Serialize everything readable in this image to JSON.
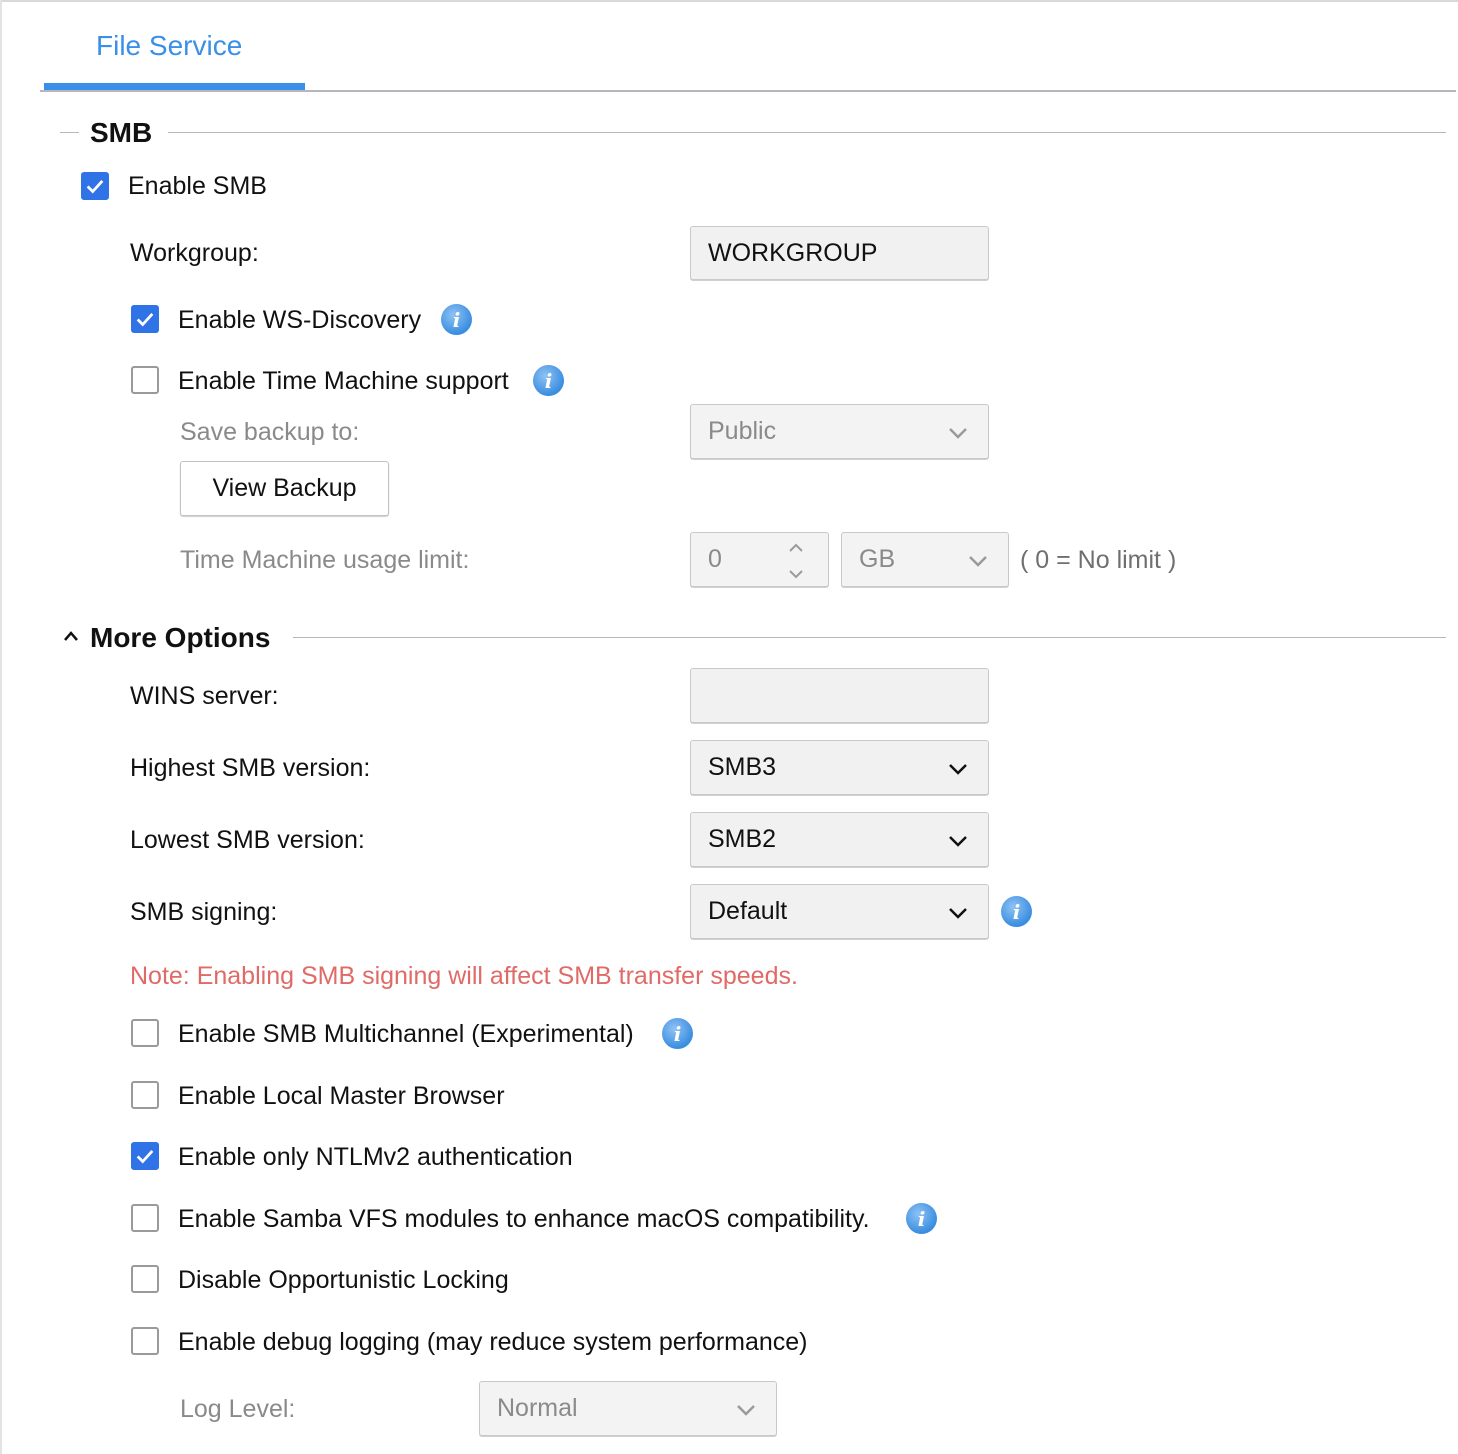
{
  "tab": {
    "label": "File Service"
  },
  "smb_section": {
    "title": "SMB",
    "enable_smb": {
      "label": "Enable SMB",
      "checked": true
    },
    "workgroup": {
      "label": "Workgroup:",
      "value": "WORKGROUP"
    },
    "ws_discovery": {
      "label": "Enable WS-Discovery",
      "checked": true
    },
    "time_machine": {
      "label": "Enable Time Machine support",
      "checked": false
    },
    "save_backup": {
      "label": "Save backup to:",
      "value": "Public"
    },
    "view_backup_button": "View Backup",
    "usage_limit": {
      "label": "Time Machine usage limit:",
      "value": "0",
      "unit": "GB",
      "hint": "( 0 = No limit )"
    }
  },
  "more_options": {
    "title": "More Options",
    "wins_server": {
      "label": "WINS server:",
      "value": ""
    },
    "highest_smb": {
      "label": "Highest SMB version:",
      "value": "SMB3"
    },
    "lowest_smb": {
      "label": "Lowest SMB version:",
      "value": "SMB2"
    },
    "smb_signing": {
      "label": "SMB signing:",
      "value": "Default"
    },
    "note": "Note: Enabling SMB signing will affect SMB transfer speeds.",
    "checkboxes": [
      {
        "label": "Enable SMB Multichannel (Experimental)",
        "checked": false
      },
      {
        "label": "Enable Local Master Browser",
        "checked": false
      },
      {
        "label": "Enable only NTLMv2 authentication",
        "checked": true
      },
      {
        "label": "Enable Samba VFS modules to enhance macOS compatibility.",
        "checked": false
      },
      {
        "label": "Disable Opportunistic Locking",
        "checked": false
      },
      {
        "label": "Enable debug logging (may reduce system performance)",
        "checked": false
      }
    ],
    "log_level": {
      "label": "Log Level:",
      "value": "Normal"
    }
  },
  "colors": {
    "accent": "#3a8fe8",
    "checkbox_on": "#2f73e6",
    "note": "#e06a66",
    "disabled_text": "#8a8a8a"
  },
  "icons": {
    "info": "info-icon",
    "checkmark": "checkmark-icon",
    "chevron": "chevron-down-icon",
    "collapse": "chevron-up-icon"
  }
}
